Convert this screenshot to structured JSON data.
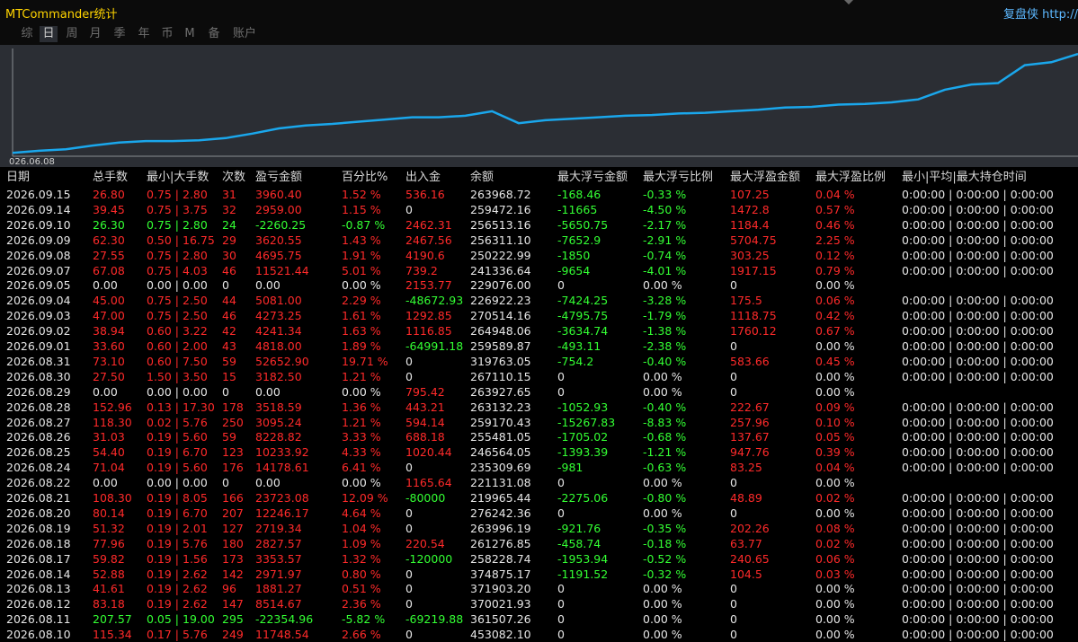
{
  "app_title": "MTCommander统计",
  "right_link": "复盘侠 http://",
  "tabs": [
    "综",
    "日",
    "周",
    "月",
    "季",
    "年",
    "币",
    "M",
    "备",
    "账户"
  ],
  "active_tab": 1,
  "chart": {
    "start_label": "026.06.08",
    "line_color": "#1aa7ec",
    "background": "#2b2e34"
  },
  "chart_data": {
    "type": "line",
    "title": "",
    "x_start_label": "026.06.08",
    "balance_curve": [
      0.0,
      0.01,
      0.03,
      0.05,
      0.07,
      0.085,
      0.1,
      0.12,
      0.14,
      0.16,
      0.18,
      0.2,
      0.22,
      0.24,
      0.26,
      0.28,
      0.3,
      0.32,
      0.335,
      0.35,
      0.37,
      0.39,
      0.41,
      0.43,
      0.45,
      0.47,
      0.5,
      0.52,
      0.55,
      0.58,
      0.61,
      0.7,
      0.73,
      0.77,
      0.81,
      0.85,
      0.88,
      0.92,
      0.96,
      1.0
    ],
    "balance_values": [
      0.72,
      0.75,
      0.77,
      0.82,
      0.86,
      0.88,
      0.88,
      0.89,
      0.92,
      0.98,
      1.05,
      1.09,
      1.11,
      1.14,
      1.17,
      1.2,
      1.2,
      1.22,
      1.28,
      1.12,
      1.16,
      1.18,
      1.2,
      1.22,
      1.23,
      1.25,
      1.26,
      1.28,
      1.3,
      1.33,
      1.34,
      1.37,
      1.38,
      1.4,
      1.44,
      1.57,
      1.64,
      1.66,
      1.9,
      1.94,
      2.05
    ]
  },
  "colors": {
    "positive": "#ff2a2a",
    "negative": "#33ff33",
    "neutral": "#e6e6e6",
    "title": "#ffd400",
    "link": "#5db8ff"
  },
  "table": {
    "headers": [
      "日期",
      "总手数",
      "最小|大手数",
      "次数",
      "盈亏金额",
      "百分比%",
      "出入金",
      "余额",
      "最大浮亏金额",
      "最大浮亏比例",
      "最大浮盈金额",
      "最大浮盈比例",
      "最小|平均|最大持仓时间"
    ],
    "rows": [
      {
        "cells": [
          "2026.09.15",
          "26.80",
          "0.75 | 2.80",
          "31",
          "3960.40",
          "1.52 %",
          "536.16",
          "263968.72",
          "-168.46",
          "-0.33 %",
          "107.25",
          "0.04 %",
          "0:00:00 | 0:00:00 | 0:00:00"
        ],
        "colors": [
          "w",
          "r",
          "r",
          "r",
          "r",
          "r",
          "r",
          "w",
          "g",
          "g",
          "r",
          "r",
          "w"
        ]
      },
      {
        "cells": [
          "2026.09.14",
          "39.45",
          "0.75 | 3.75",
          "32",
          "2959.00",
          "1.15 %",
          "0",
          "259472.16",
          "-11665",
          "-4.50 %",
          "1472.8",
          "0.57 %",
          "0:00:00 | 0:00:00 | 0:00:00"
        ],
        "colors": [
          "w",
          "r",
          "r",
          "r",
          "r",
          "r",
          "w",
          "w",
          "g",
          "g",
          "r",
          "r",
          "w"
        ]
      },
      {
        "cells": [
          "2026.09.10",
          "26.30",
          "0.75 | 2.80",
          "24",
          "-2260.25",
          "-0.87 %",
          "2462.31",
          "256513.16",
          "-5650.75",
          "-2.17 %",
          "1184.4",
          "0.46 %",
          "0:00:00 | 0:00:00 | 0:00:00"
        ],
        "colors": [
          "w",
          "g",
          "g",
          "g",
          "g",
          "g",
          "r",
          "w",
          "g",
          "g",
          "r",
          "r",
          "w"
        ]
      },
      {
        "cells": [
          "2026.09.09",
          "62.30",
          "0.50 | 16.75",
          "29",
          "3620.55",
          "1.43 %",
          "2467.56",
          "256311.10",
          "-7652.9",
          "-2.91 %",
          "5704.75",
          "2.25 %",
          "0:00:00 | 0:00:00 | 0:00:00"
        ],
        "colors": [
          "w",
          "r",
          "r",
          "r",
          "r",
          "r",
          "r",
          "w",
          "g",
          "g",
          "r",
          "r",
          "w"
        ]
      },
      {
        "cells": [
          "2026.09.08",
          "27.55",
          "0.75 | 2.80",
          "30",
          "4695.75",
          "1.91 %",
          "4190.6",
          "250222.99",
          "-1850",
          "-0.74 %",
          "303.25",
          "0.12 %",
          "0:00:00 | 0:00:00 | 0:00:00"
        ],
        "colors": [
          "w",
          "r",
          "r",
          "r",
          "r",
          "r",
          "r",
          "w",
          "g",
          "g",
          "r",
          "r",
          "w"
        ]
      },
      {
        "cells": [
          "2026.09.07",
          "67.08",
          "0.75 | 4.03",
          "46",
          "11521.44",
          "5.01 %",
          "739.2",
          "241336.64",
          "-9654",
          "-4.01 %",
          "1917.15",
          "0.79 %",
          "0:00:00 | 0:00:00 | 0:00:00"
        ],
        "colors": [
          "w",
          "r",
          "r",
          "r",
          "r",
          "r",
          "r",
          "w",
          "g",
          "g",
          "r",
          "r",
          "w"
        ]
      },
      {
        "cells": [
          "2026.09.05",
          "0.00",
          "0.00 | 0.00",
          "0",
          "0.00",
          "0.00 %",
          "2153.77",
          "229076.00",
          "0",
          "0.00 %",
          "0",
          "0.00 %",
          ""
        ],
        "colors": [
          "w",
          "w",
          "w",
          "w",
          "w",
          "w",
          "r",
          "w",
          "w",
          "w",
          "w",
          "w",
          "w"
        ]
      },
      {
        "cells": [
          "2026.09.04",
          "45.00",
          "0.75 | 2.50",
          "44",
          "5081.00",
          "2.29 %",
          "-48672.93",
          "226922.23",
          "-7424.25",
          "-3.28 %",
          "175.5",
          "0.06 %",
          "0:00:00 | 0:00:00 | 0:00:00"
        ],
        "colors": [
          "w",
          "r",
          "r",
          "r",
          "r",
          "r",
          "g",
          "w",
          "g",
          "g",
          "r",
          "r",
          "w"
        ]
      },
      {
        "cells": [
          "2026.09.03",
          "47.00",
          "0.75 | 2.50",
          "46",
          "4273.25",
          "1.61 %",
          "1292.85",
          "270514.16",
          "-4795.75",
          "-1.79 %",
          "1118.75",
          "0.42 %",
          "0:00:00 | 0:00:00 | 0:00:00"
        ],
        "colors": [
          "w",
          "r",
          "r",
          "r",
          "r",
          "r",
          "r",
          "w",
          "g",
          "g",
          "r",
          "r",
          "w"
        ]
      },
      {
        "cells": [
          "2026.09.02",
          "38.94",
          "0.60 | 3.22",
          "42",
          "4241.34",
          "1.63 %",
          "1116.85",
          "264948.06",
          "-3634.74",
          "-1.38 %",
          "1760.12",
          "0.67 %",
          "0:00:00 | 0:00:00 | 0:00:00"
        ],
        "colors": [
          "w",
          "r",
          "r",
          "r",
          "r",
          "r",
          "r",
          "w",
          "g",
          "g",
          "r",
          "r",
          "w"
        ]
      },
      {
        "cells": [
          "2026.09.01",
          "33.60",
          "0.60 | 2.00",
          "43",
          "4818.00",
          "1.89 %",
          "-64991.18",
          "259589.87",
          "-493.11",
          "-2.38 %",
          "0",
          "0.00 %",
          "0:00:00 | 0:00:00 | 0:00:00"
        ],
        "colors": [
          "w",
          "r",
          "r",
          "r",
          "r",
          "r",
          "g",
          "w",
          "g",
          "g",
          "w",
          "w",
          "w"
        ]
      },
      {
        "cells": [
          "2026.08.31",
          "73.10",
          "0.60 | 7.50",
          "59",
          "52652.90",
          "19.71 %",
          "0",
          "319763.05",
          "-754.2",
          "-0.40 %",
          "583.66",
          "0.45 %",
          "0:00:00 | 0:00:00 | 0:00:00"
        ],
        "colors": [
          "w",
          "r",
          "r",
          "r",
          "r",
          "r",
          "w",
          "w",
          "g",
          "g",
          "r",
          "r",
          "w"
        ]
      },
      {
        "cells": [
          "2026.08.30",
          "27.50",
          "1.50 | 3.50",
          "15",
          "3182.50",
          "1.21 %",
          "0",
          "267110.15",
          "0",
          "0.00 %",
          "0",
          "0.00 %",
          "0:00:00 | 0:00:00 | 0:00:00"
        ],
        "colors": [
          "w",
          "r",
          "r",
          "r",
          "r",
          "r",
          "w",
          "w",
          "w",
          "w",
          "w",
          "w",
          "w"
        ]
      },
      {
        "cells": [
          "2026.08.29",
          "0.00",
          "0.00 | 0.00",
          "0",
          "0.00",
          "0.00 %",
          "795.42",
          "263927.65",
          "0",
          "0.00 %",
          "0",
          "0.00 %",
          ""
        ],
        "colors": [
          "w",
          "w",
          "w",
          "w",
          "w",
          "w",
          "r",
          "w",
          "w",
          "w",
          "w",
          "w",
          "w"
        ]
      },
      {
        "cells": [
          "2026.08.28",
          "152.96",
          "0.13 | 17.30",
          "178",
          "3518.59",
          "1.36 %",
          "443.21",
          "263132.23",
          "-1052.93",
          "-0.40 %",
          "222.67",
          "0.09 %",
          "0:00:00 | 0:00:00 | 0:00:00"
        ],
        "colors": [
          "w",
          "r",
          "r",
          "r",
          "r",
          "r",
          "r",
          "w",
          "g",
          "g",
          "r",
          "r",
          "w"
        ]
      },
      {
        "cells": [
          "2026.08.27",
          "118.30",
          "0.02 | 5.76",
          "250",
          "3095.24",
          "1.21 %",
          "594.14",
          "259170.43",
          "-15267.83",
          "-8.83 %",
          "257.96",
          "0.10 %",
          "0:00:00 | 0:00:00 | 0:00:00"
        ],
        "colors": [
          "w",
          "r",
          "r",
          "r",
          "r",
          "r",
          "r",
          "w",
          "g",
          "g",
          "r",
          "r",
          "w"
        ]
      },
      {
        "cells": [
          "2026.08.26",
          "31.03",
          "0.19 | 5.60",
          "59",
          "8228.82",
          "3.33 %",
          "688.18",
          "255481.05",
          "-1705.02",
          "-0.68 %",
          "137.67",
          "0.05 %",
          "0:00:00 | 0:00:00 | 0:00:00"
        ],
        "colors": [
          "w",
          "r",
          "r",
          "r",
          "r",
          "r",
          "r",
          "w",
          "g",
          "g",
          "r",
          "r",
          "w"
        ]
      },
      {
        "cells": [
          "2026.08.25",
          "54.40",
          "0.19 | 6.70",
          "123",
          "10233.92",
          "4.33 %",
          "1020.44",
          "246564.05",
          "-1393.39",
          "-1.21 %",
          "947.76",
          "0.39 %",
          "0:00:00 | 0:00:00 | 0:00:00"
        ],
        "colors": [
          "w",
          "r",
          "r",
          "r",
          "r",
          "r",
          "r",
          "w",
          "g",
          "g",
          "r",
          "r",
          "w"
        ]
      },
      {
        "cells": [
          "2026.08.24",
          "71.04",
          "0.19 | 5.60",
          "176",
          "14178.61",
          "6.41 %",
          "0",
          "235309.69",
          "-981",
          "-0.63 %",
          "83.25",
          "0.04 %",
          "0:00:00 | 0:00:00 | 0:00:00"
        ],
        "colors": [
          "w",
          "r",
          "r",
          "r",
          "r",
          "r",
          "w",
          "w",
          "g",
          "g",
          "r",
          "r",
          "w"
        ]
      },
      {
        "cells": [
          "2026.08.22",
          "0.00",
          "0.00 | 0.00",
          "0",
          "0.00",
          "0.00 %",
          "1165.64",
          "221131.08",
          "0",
          "0.00 %",
          "0",
          "0.00 %",
          ""
        ],
        "colors": [
          "w",
          "w",
          "w",
          "w",
          "w",
          "w",
          "r",
          "w",
          "w",
          "w",
          "w",
          "w",
          "w"
        ]
      },
      {
        "cells": [
          "2026.08.21",
          "108.30",
          "0.19 | 8.05",
          "166",
          "23723.08",
          "12.09 %",
          "-80000",
          "219965.44",
          "-2275.06",
          "-0.80 %",
          "48.89",
          "0.02 %",
          "0:00:00 | 0:00:00 | 0:00:00"
        ],
        "colors": [
          "w",
          "r",
          "r",
          "r",
          "r",
          "r",
          "g",
          "w",
          "g",
          "g",
          "r",
          "r",
          "w"
        ]
      },
      {
        "cells": [
          "2026.08.20",
          "80.14",
          "0.19 | 6.70",
          "207",
          "12246.17",
          "4.64 %",
          "0",
          "276242.36",
          "0",
          "0.00 %",
          "0",
          "0.00 %",
          "0:00:00 | 0:00:00 | 0:00:00"
        ],
        "colors": [
          "w",
          "r",
          "r",
          "r",
          "r",
          "r",
          "w",
          "w",
          "w",
          "w",
          "w",
          "w",
          "w"
        ]
      },
      {
        "cells": [
          "2026.08.19",
          "51.32",
          "0.19 | 2.01",
          "127",
          "2719.34",
          "1.04 %",
          "0",
          "263996.19",
          "-921.76",
          "-0.35 %",
          "202.26",
          "0.08 %",
          "0:00:00 | 0:00:00 | 0:00:00"
        ],
        "colors": [
          "w",
          "r",
          "r",
          "r",
          "r",
          "r",
          "w",
          "w",
          "g",
          "g",
          "r",
          "r",
          "w"
        ]
      },
      {
        "cells": [
          "2026.08.18",
          "77.96",
          "0.19 | 5.76",
          "180",
          "2827.57",
          "1.09 %",
          "220.54",
          "261276.85",
          "-458.74",
          "-0.18 %",
          "63.77",
          "0.02 %",
          "0:00:00 | 0:00:00 | 0:00:00"
        ],
        "colors": [
          "w",
          "r",
          "r",
          "r",
          "r",
          "r",
          "r",
          "w",
          "g",
          "g",
          "r",
          "r",
          "w"
        ]
      },
      {
        "cells": [
          "2026.08.17",
          "59.82",
          "0.19 | 1.56",
          "173",
          "3353.57",
          "1.32 %",
          "-120000",
          "258228.74",
          "-1953.94",
          "-0.52 %",
          "240.65",
          "0.06 %",
          "0:00:00 | 0:00:00 | 0:00:00"
        ],
        "colors": [
          "w",
          "r",
          "r",
          "r",
          "r",
          "r",
          "g",
          "w",
          "g",
          "g",
          "r",
          "r",
          "w"
        ]
      },
      {
        "cells": [
          "2026.08.14",
          "52.88",
          "0.19 | 2.62",
          "142",
          "2971.97",
          "0.80 %",
          "0",
          "374875.17",
          "-1191.52",
          "-0.32 %",
          "104.5",
          "0.03 %",
          "0:00:00 | 0:00:00 | 0:00:00"
        ],
        "colors": [
          "w",
          "r",
          "r",
          "r",
          "r",
          "r",
          "w",
          "w",
          "g",
          "g",
          "r",
          "r",
          "w"
        ]
      },
      {
        "cells": [
          "2026.08.13",
          "41.61",
          "0.19 | 2.62",
          "96",
          "1881.27",
          "0.51 %",
          "0",
          "371903.20",
          "0",
          "0.00 %",
          "0",
          "0.00 %",
          "0:00:00 | 0:00:00 | 0:00:00"
        ],
        "colors": [
          "w",
          "r",
          "r",
          "r",
          "r",
          "r",
          "w",
          "w",
          "w",
          "w",
          "w",
          "w",
          "w"
        ]
      },
      {
        "cells": [
          "2026.08.12",
          "83.18",
          "0.19 | 2.62",
          "147",
          "8514.67",
          "2.36 %",
          "0",
          "370021.93",
          "0",
          "0.00 %",
          "0",
          "0.00 %",
          "0:00:00 | 0:00:00 | 0:00:00"
        ],
        "colors": [
          "w",
          "r",
          "r",
          "r",
          "r",
          "r",
          "w",
          "w",
          "w",
          "w",
          "w",
          "w",
          "w"
        ]
      },
      {
        "cells": [
          "2026.08.11",
          "207.57",
          "0.05 | 19.00",
          "295",
          "-22354.96",
          "-5.82 %",
          "-69219.88",
          "361507.26",
          "0",
          "0.00 %",
          "0",
          "0.00 %",
          "0:00:00 | 0:00:00 | 0:00:00"
        ],
        "colors": [
          "w",
          "g",
          "g",
          "g",
          "g",
          "g",
          "g",
          "w",
          "w",
          "w",
          "w",
          "w",
          "w"
        ]
      },
      {
        "cells": [
          "2026.08.10",
          "115.34",
          "0.17 | 5.76",
          "249",
          "11748.54",
          "2.66 %",
          "0",
          "453082.10",
          "0",
          "0.00 %",
          "0",
          "0.00 %",
          "0:00:00 | 0:00:00 | 0:00:00"
        ],
        "colors": [
          "w",
          "r",
          "r",
          "r",
          "r",
          "r",
          "w",
          "w",
          "w",
          "w",
          "w",
          "w",
          "w"
        ]
      }
    ]
  }
}
